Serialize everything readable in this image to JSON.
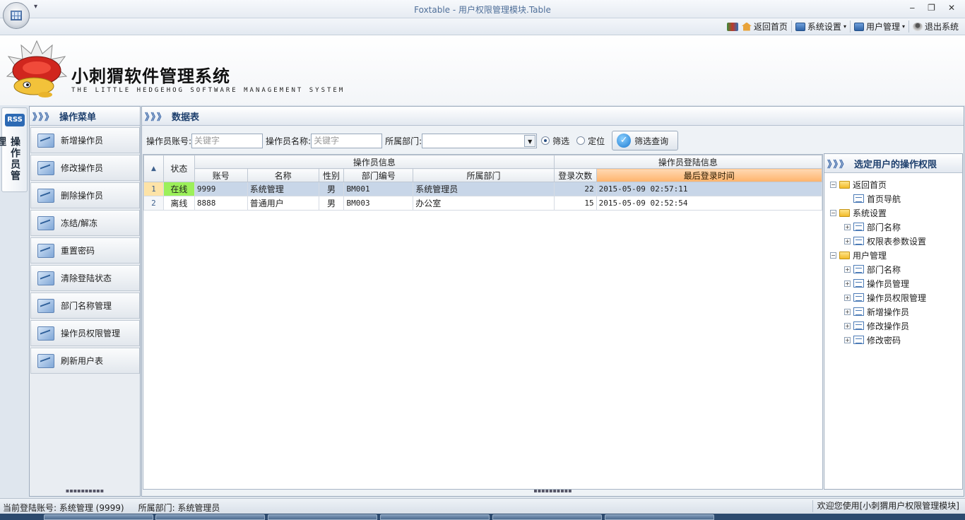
{
  "window": {
    "title": "Foxtable - 用户权限管理模块.Table",
    "qat_glyph": "▾",
    "controls": [
      "‒",
      "❐",
      "✕"
    ]
  },
  "menu": {
    "items": [
      {
        "label": "返回首页",
        "icon": "home-icon",
        "dropdown": false
      },
      {
        "label": "系统设置",
        "icon": "settings-window-icon",
        "dropdown": true
      },
      {
        "label": "用户管理",
        "icon": "users-window-icon",
        "dropdown": true
      },
      {
        "label": "退出系统",
        "icon": "exit-icon",
        "dropdown": false
      }
    ]
  },
  "banner": {
    "title": "小刺猬软件管理系统",
    "subtitle": "THE LITTLE HEDGEHOG SOFTWARE MANAGEMENT SYSTEM"
  },
  "side_tab": {
    "rss": "RSS",
    "label": "操作员管理"
  },
  "left_panel": {
    "header": "操作菜单",
    "chevrons": "》》》",
    "buttons": [
      "新增操作员",
      "修改操作员",
      "删除操作员",
      "冻结/解冻",
      "重置密码",
      "清除登陆状态",
      "部门名称管理",
      "操作员权限管理",
      "刷新用户表"
    ],
    "grip": "▪▪▪▪▪▪▪▪▪▪"
  },
  "center_panel": {
    "header": "数据表",
    "chevrons": "》》》",
    "filter": {
      "account_label": "操作员账号:",
      "account_placeholder": "关键字",
      "name_label": "操作员名称:",
      "name_placeholder": "关键字",
      "dept_label": "所属部门:",
      "dept_value": "",
      "radio_filter": "筛选",
      "radio_locate": "定位",
      "query_button": "筛选查询"
    },
    "table": {
      "corner": "▲",
      "status_header": "状态",
      "group1": "操作员信息",
      "group2": "操作员登陆信息",
      "columns": [
        "账号",
        "名称",
        "性别",
        "部门编号",
        "所属部门",
        "登录次数",
        "最后登录时间"
      ],
      "rows": [
        {
          "no": "1",
          "status": "在线",
          "account": "9999",
          "name": "系统管理",
          "gender": "男",
          "dept_code": "BM001",
          "dept": "系统管理员",
          "logins": "22",
          "last_login": "2015-05-09 02:57:11"
        },
        {
          "no": "2",
          "status": "离线",
          "account": "8888",
          "name": "普通用户",
          "gender": "男",
          "dept_code": "BM003",
          "dept": "办公室",
          "logins": "15",
          "last_login": "2015-05-09 02:52:54"
        }
      ]
    },
    "grip": "▪▪▪▪▪▪▪▪▪▪"
  },
  "right_panel": {
    "header": "选定用户的操作权限",
    "chevrons": "》》》",
    "tree": [
      {
        "label": "返回首页",
        "level": 0,
        "type": "folder",
        "toggle": "−"
      },
      {
        "label": "首页导航",
        "level": 1,
        "type": "doc",
        "toggle": ""
      },
      {
        "label": "系统设置",
        "level": 0,
        "type": "folder",
        "toggle": "−"
      },
      {
        "label": "部门名称",
        "level": 1,
        "type": "doc",
        "toggle": "+"
      },
      {
        "label": "权限表参数设置",
        "level": 1,
        "type": "doc",
        "toggle": "+"
      },
      {
        "label": "用户管理",
        "level": 0,
        "type": "folder",
        "toggle": "−"
      },
      {
        "label": "部门名称",
        "level": 1,
        "type": "doc",
        "toggle": "+"
      },
      {
        "label": "操作员管理",
        "level": 1,
        "type": "doc",
        "toggle": "+"
      },
      {
        "label": "操作员权限管理",
        "level": 1,
        "type": "doc",
        "toggle": "+"
      },
      {
        "label": "新增操作员",
        "level": 1,
        "type": "doc",
        "toggle": "+"
      },
      {
        "label": "修改操作员",
        "level": 1,
        "type": "doc",
        "toggle": "+"
      },
      {
        "label": "修改密码",
        "level": 1,
        "type": "doc",
        "toggle": "+"
      }
    ]
  },
  "statusbar": {
    "account": "当前登陆账号: 系统管理 (9999)",
    "dept": "所属部门: 系统管理员",
    "welcome": "欢迎您使用[小刺猬用户权限管理模块]"
  },
  "colors": {
    "online": "#9cf05a",
    "selected_row": "#c8d6e8",
    "highlight_header": "#ffb36b",
    "header_text": "#1d3f6d"
  }
}
